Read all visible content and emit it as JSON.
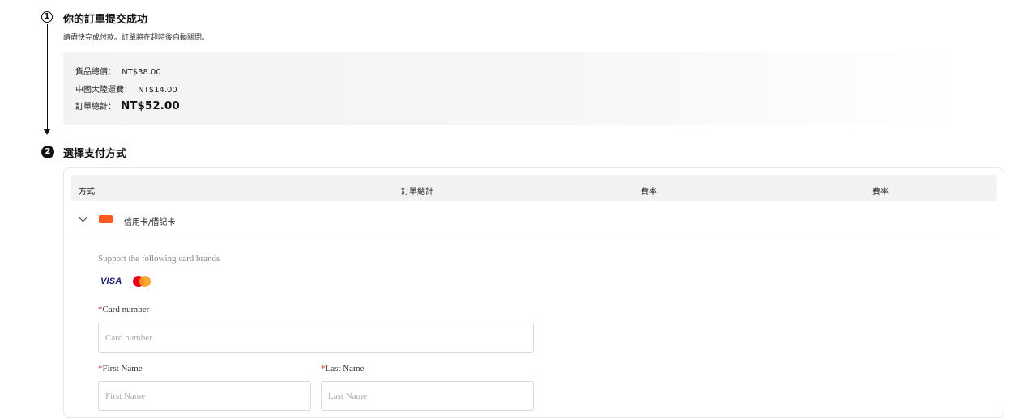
{
  "step1": {
    "number": "1",
    "title": "你的訂單提交成功",
    "subtitle": "請盡快完成付款。訂單將在超時後自動關閉。"
  },
  "summary": {
    "goods_label": "貨品總價：",
    "goods_value": "NT$38.00",
    "shipping_label": "中國大陸運費：",
    "shipping_value": "NT$14.00",
    "total_label": "訂單總計：",
    "total_value": "NT$52.00"
  },
  "step2": {
    "number": "2",
    "title": "選擇支付方式"
  },
  "table": {
    "headers": [
      "方式",
      "訂單總計",
      "費率",
      "費率"
    ]
  },
  "method": {
    "label": "信用卡/借記卡",
    "icon": "credit-card-icon",
    "support_text": "Support the following card brands",
    "brands": [
      "VISA",
      "mastercard-logo"
    ]
  },
  "form": {
    "card_number_label": "Card number",
    "card_number_placeholder": "Card number",
    "first_name_label": "First Name",
    "first_name_placeholder": "First Name",
    "last_name_label": "Last Name",
    "last_name_placeholder": "Last Name",
    "required_mark": "*"
  },
  "colors": {
    "accent": "#ff5a1f",
    "required": "#e2231a",
    "summary_bg": "#f3f3f3",
    "table_head_bg": "#f2f2f2"
  }
}
